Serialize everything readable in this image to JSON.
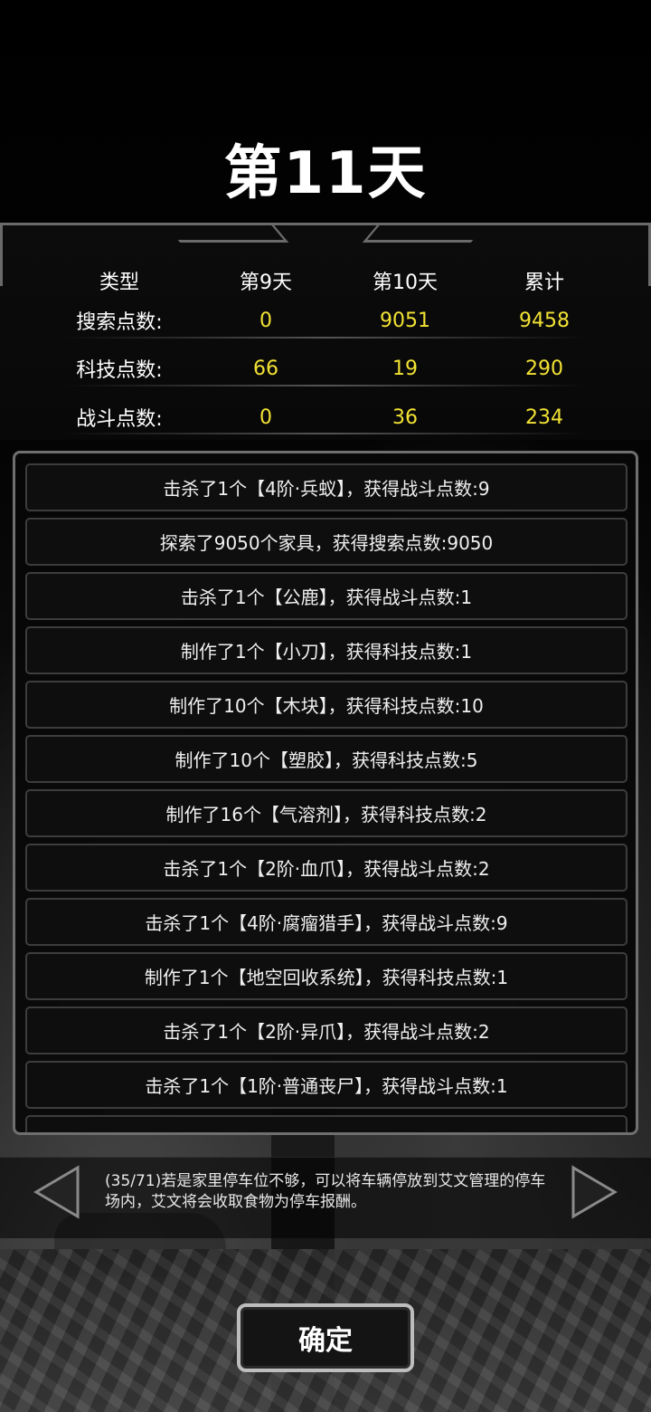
{
  "day_title": "第11天",
  "stats": {
    "headers": [
      "类型",
      "第9天",
      "第10天",
      "累计"
    ],
    "rows": [
      {
        "label": "搜索点数:",
        "day9": "0",
        "day10": "9051",
        "total": "9458"
      },
      {
        "label": "科技点数:",
        "day9": "66",
        "day10": "19",
        "total": "290"
      },
      {
        "label": "战斗点数:",
        "day9": "0",
        "day10": "36",
        "total": "234"
      }
    ]
  },
  "log": [
    "击杀了1个【4阶·兵蚁】，获得战斗点数:9",
    "探索了9050个家具，获得搜索点数:9050",
    "击杀了1个【公鹿】，获得战斗点数:1",
    "制作了1个【小刀】，获得科技点数:1",
    "制作了10个【木块】，获得科技点数:10",
    "制作了10个【塑胶】，获得科技点数:5",
    "制作了16个【气溶剂】，获得科技点数:2",
    "击杀了1个【2阶·血爪】，获得战斗点数:2",
    "击杀了1个【4阶·腐瘤猎手】，获得战斗点数:9",
    "制作了1个【地空回收系统】，获得科技点数:1",
    "击杀了1个【2阶·异爪】，获得战斗点数:2",
    "击杀了1个【1阶·普通丧尸】，获得战斗点数:1"
  ],
  "tip": "(35/71)若是家里停车位不够，可以将车辆停放到艾文管理的停车场内，艾文将会收取食物为停车报酬。",
  "confirm_label": "确定",
  "colors": {
    "value": "#f2e234",
    "text": "#ffffff",
    "border": "#6f6f6f"
  }
}
